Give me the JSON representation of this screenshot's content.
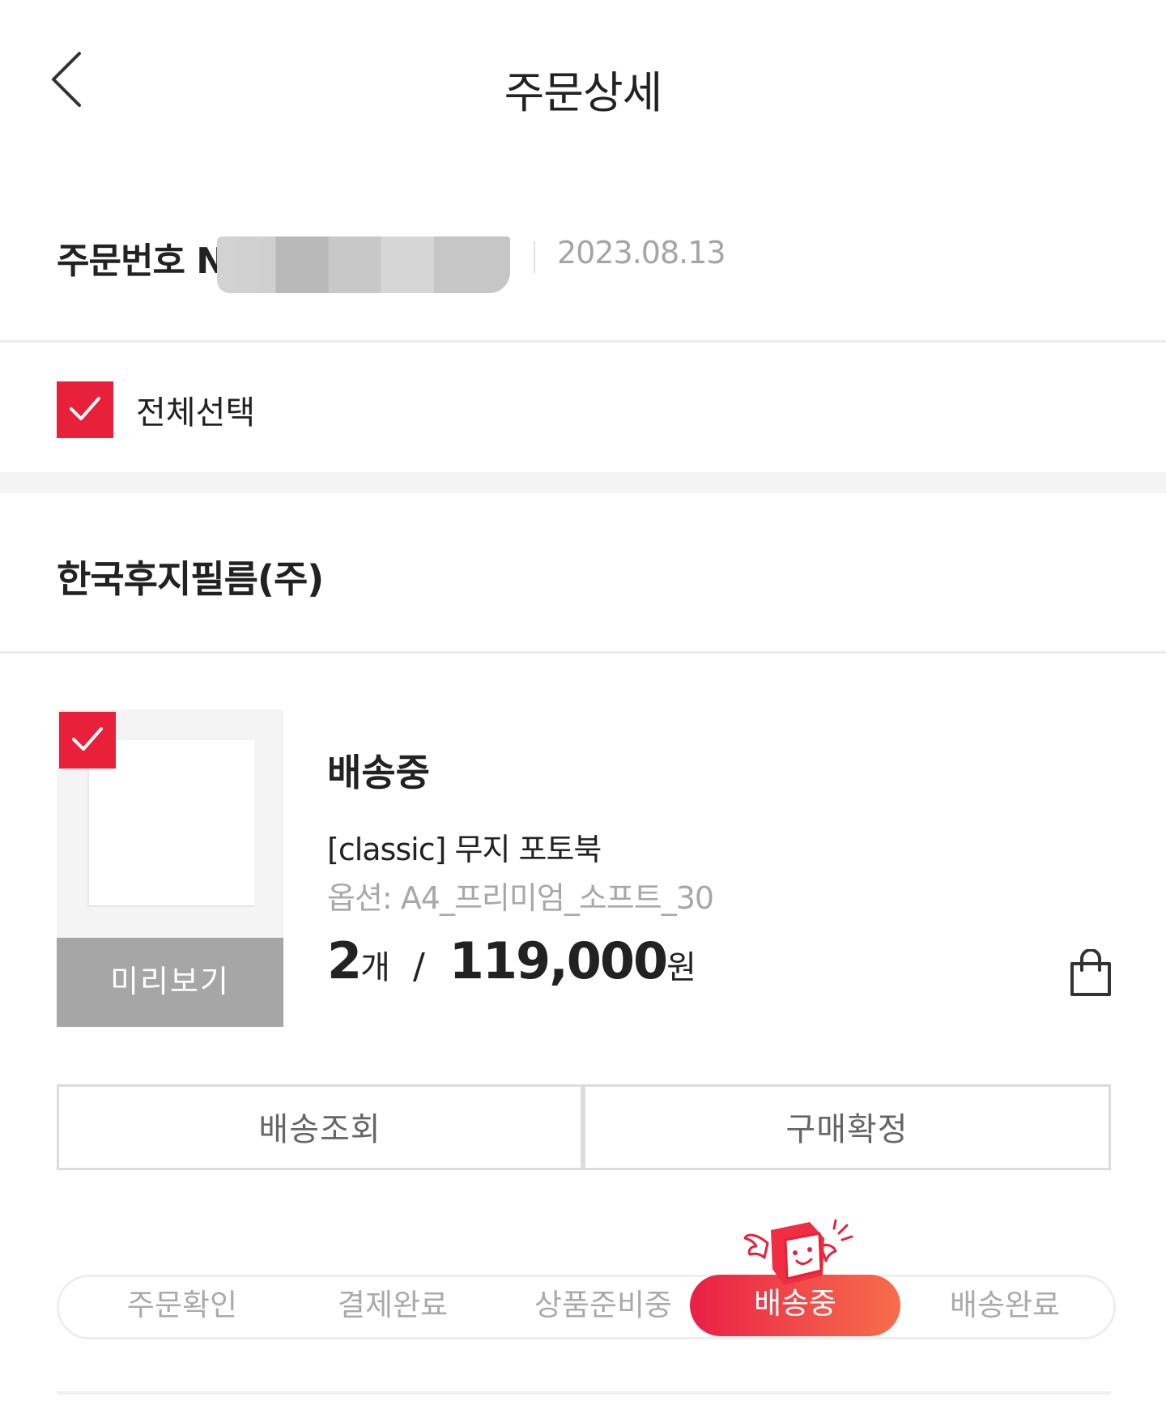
{
  "header": {
    "title": "주문상세",
    "back_icon": "chevron-left-icon"
  },
  "order": {
    "label": "주문번호 N",
    "date": "2023.08.13"
  },
  "select_all": {
    "label": "전체선택",
    "checked": true
  },
  "seller": {
    "name": "한국후지필름(주)"
  },
  "item": {
    "status": "배송중",
    "product_name": "[classic] 무지 포토북",
    "option": "옵션: A4_프리미엄_소프트_30",
    "quantity": "2",
    "quantity_unit": "개",
    "separator": "/",
    "price": "119,000",
    "currency": "원",
    "preview_label": "미리보기",
    "checked": true,
    "cart_icon": "shopping-bag-icon"
  },
  "actions": {
    "track_label": "배송조회",
    "confirm_label": "구매확정"
  },
  "progress": {
    "steps": [
      "주문확인",
      "결제완료",
      "상품준비중",
      "배송중",
      "배송완료"
    ],
    "active_index": 3,
    "mascot_icon": "winged-box-mascot-icon"
  },
  "colors": {
    "accent": "#e8203a",
    "gradient_start": "#ea1f45",
    "gradient_end": "#f86d4a",
    "muted": "#aaaaaa",
    "preview_bg": "#a6a6a6"
  }
}
